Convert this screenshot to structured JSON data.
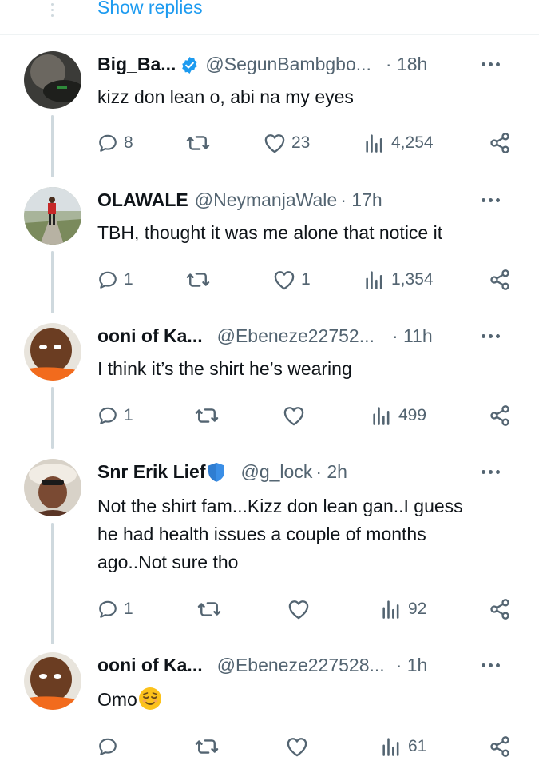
{
  "show_replies_label": "Show replies",
  "colors": {
    "link": "#1d9bf0",
    "secondary": "#536471",
    "thread_line": "#cfd9de",
    "verified": "#1d9bf0"
  },
  "replies": [
    {
      "name": "Big_Ba...",
      "badge": "verified-badge-icon",
      "handle": "@SegunBambgbo...",
      "time": "· 18h",
      "text": "kizz don lean o, abi na my eyes",
      "replies": "8",
      "reposts": "",
      "likes": "23",
      "views": "4,254"
    },
    {
      "name": "OLAWALE",
      "handle": "@NeymanjaWale",
      "time": "· 17h",
      "text": "TBH, thought it was me alone that notice it",
      "replies": "1",
      "reposts": "",
      "likes": "1",
      "views": "1,354"
    },
    {
      "name": "ooni of Ka...",
      "handle": "@Ebeneze22752...",
      "time": "· 11h",
      "text": "I think it’s the shirt he’s wearing",
      "replies": "1",
      "reposts": "",
      "likes": "",
      "views": "499"
    },
    {
      "name": "Snr Erik Lief",
      "badge": "shield-icon",
      "handle": "@g_lock",
      "time": "· 2h",
      "text": "Not the shirt fam...Kizz don lean gan..I guess he had health issues a couple of months ago..Not sure tho",
      "replies": "1",
      "reposts": "",
      "likes": "",
      "views": "92"
    },
    {
      "name": "ooni of Ka...",
      "handle": "@Ebeneze227528...",
      "time": "· 1h",
      "text": "Omo",
      "emoji": "relieved-face-emoji",
      "replies": "",
      "reposts": "",
      "likes": "",
      "views": "61"
    }
  ]
}
